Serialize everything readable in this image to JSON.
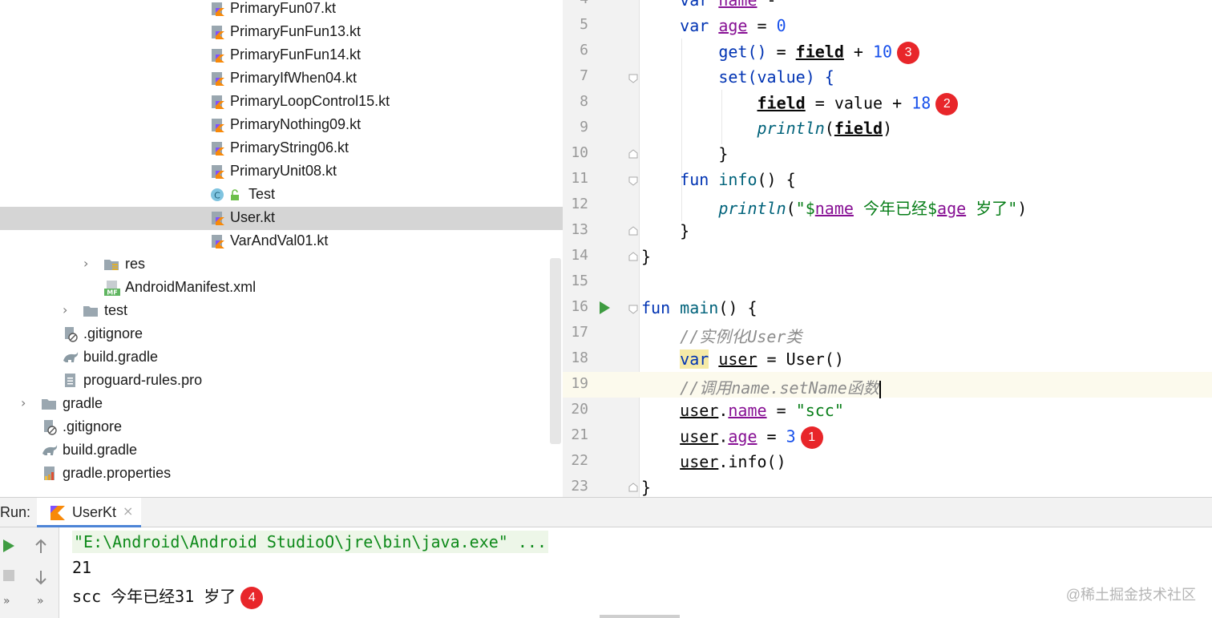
{
  "project_tree": {
    "items": [
      {
        "label": "PrimaryFun07.kt",
        "type": "kotlin-file"
      },
      {
        "label": "PrimaryFunFun13.kt",
        "type": "kotlin-file"
      },
      {
        "label": "PrimaryFunFun14.kt",
        "type": "kotlin-file"
      },
      {
        "label": "PrimaryIfWhen04.kt",
        "type": "kotlin-file"
      },
      {
        "label": "PrimaryLoopControl15.kt",
        "type": "kotlin-file"
      },
      {
        "label": "PrimaryNothing09.kt",
        "type": "kotlin-file"
      },
      {
        "label": "PrimaryString06.kt",
        "type": "kotlin-file"
      },
      {
        "label": "PrimaryUnit08.kt",
        "type": "kotlin-file"
      },
      {
        "label": "Test",
        "type": "class",
        "badge": "C"
      },
      {
        "label": "User.kt",
        "type": "kotlin-file",
        "selected": true
      },
      {
        "label": "VarAndVal01.kt",
        "type": "kotlin-file"
      },
      {
        "label": "res",
        "type": "folder-collapsed"
      },
      {
        "label": "AndroidManifest.xml",
        "type": "manifest",
        "badge": "MF"
      },
      {
        "label": "test",
        "type": "folder-collapsed"
      },
      {
        "label": ".gitignore",
        "type": "ignore-file"
      },
      {
        "label": "build.gradle",
        "type": "gradle-file"
      },
      {
        "label": "proguard-rules.pro",
        "type": "text-file"
      },
      {
        "label": "gradle",
        "type": "folder-collapsed"
      },
      {
        "label": ".gitignore",
        "type": "ignore-file"
      },
      {
        "label": "build.gradle",
        "type": "gradle-file"
      },
      {
        "label": "gradle.properties",
        "type": "properties-file"
      }
    ]
  },
  "editor": {
    "line_numbers": [
      "4",
      "5",
      "6",
      "7",
      "8",
      "9",
      "10",
      "11",
      "12",
      "13",
      "14",
      "15",
      "16",
      "17",
      "18",
      "19",
      "20",
      "21",
      "22",
      "23"
    ],
    "tokens": {
      "var": "var",
      "name": "name",
      "age": "age",
      "eq": " = ",
      "zero": "0",
      "get": "get()",
      "field": "field",
      "plus": " + ",
      "ten": "10",
      "set": "set(value) {",
      "value_plus": " = value + ",
      "eighteen": "18",
      "println": "println",
      "lp": "(",
      "rp": ")",
      "close_brace": "}",
      "fun": "fun",
      "info": "info",
      "info_open": "() {",
      "str_open": "\"$",
      "str_mid": " 今年已经$",
      "str_end": " 岁了\"",
      "main": "main",
      "comment1": "//实例化User类",
      "user": "user",
      "user_ctor": " = User()",
      "comment2": "//调用name.setName函数",
      "scc": "\"scc\"",
      "dot": ".",
      "three": "3",
      "info_call": "info()",
      "dash": " -"
    },
    "badges": {
      "b1": "1",
      "b2": "2",
      "b3": "3"
    }
  },
  "run_panel": {
    "label": "Run:",
    "tab_title": "UserKt",
    "tab_close": "×",
    "console_lines": {
      "cmd": "\"E:\\Android\\Android StudioO\\jre\\bin\\java.exe\" ...",
      "out1": "21",
      "out2": "scc 今年已经31 岁了"
    },
    "badge4": "4",
    "side_more": "»"
  },
  "watermark": "@稀土掘金技术社区",
  "colors": {
    "keyword": "#0033b3",
    "property": "#871094",
    "number": "#1750eb",
    "string": "#067d17",
    "comment": "#8c8c8c",
    "badge": "#e8262a",
    "run_green": "#3e9c41",
    "selection": "#d5d5d5"
  },
  "icons": {
    "kotlin-file": "kotlin-file-icon",
    "class": "class-icon",
    "folder": "folder-icon",
    "run": "run-icon",
    "stop": "stop-icon",
    "up": "arrow-up-icon",
    "down": "arrow-down-icon"
  }
}
